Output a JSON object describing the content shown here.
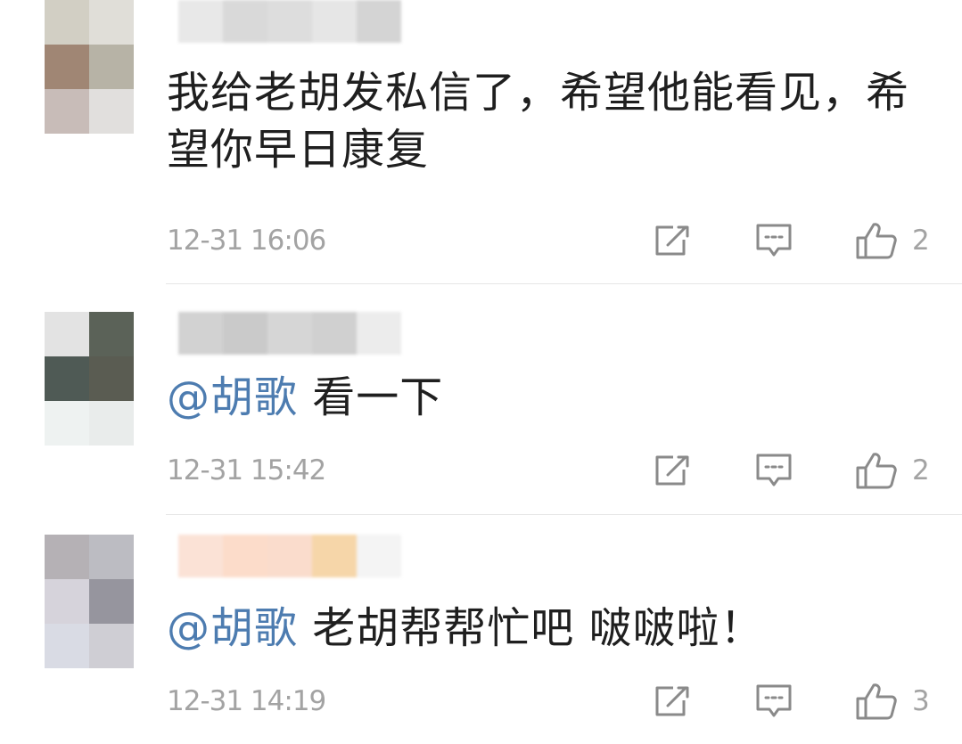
{
  "comments": [
    {
      "text_plain": "我给老胡发私信了，希望他能看见，希望你早日康复",
      "mention": "",
      "text_after": "",
      "time": "12-31 16:06",
      "likes": "2",
      "avatar_colors": [
        "#d2cfc4",
        "#e0ded8",
        "#a08674",
        "#b7b3a6",
        "#c8bcb8",
        "#e1dfdd"
      ]
    },
    {
      "text_plain": "",
      "mention": "@胡歌",
      "text_after": " 看一下",
      "time": "12-31 15:42",
      "likes": "2",
      "avatar_colors": [
        "#e3e3e3",
        "#5b6258",
        "#4f5a55",
        "#5a5c52",
        "#eef2f1",
        "#e9eceb"
      ]
    },
    {
      "text_plain": "",
      "mention": "@胡歌",
      "text_after": " 老胡帮帮忙吧 啵啵啦！",
      "time": "12-31 14:19",
      "likes": "3",
      "avatar_colors": [
        "#b5b1b5",
        "#bcbcc2",
        "#d6d3db",
        "#96959e",
        "#d9dbe4",
        "#cfced4"
      ]
    }
  ],
  "icons": {
    "share": "share-edit-icon",
    "comment": "comment-bubble-icon",
    "like": "thumbs-up-icon"
  },
  "colors": {
    "mention": "#4d7cb0",
    "meta_text": "#a3a3a3",
    "icon_stroke": "#8a8a8a",
    "divider": "#e6e6e6"
  }
}
